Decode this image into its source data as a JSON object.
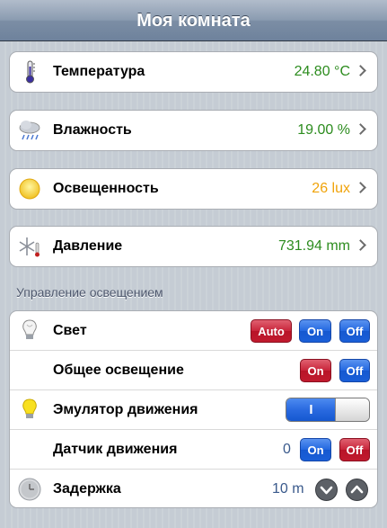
{
  "header": {
    "title": "Моя комната"
  },
  "sensors": [
    {
      "label": "Температура",
      "value": "24.80 °C",
      "icon": "thermometer-icon"
    },
    {
      "label": "Влажность",
      "value": "19.00 %",
      "icon": "rain-cloud-icon"
    },
    {
      "label": "Освещенность",
      "value": "26 lux",
      "icon": "sun-icon"
    },
    {
      "label": "Давление",
      "value": "731.94 mm",
      "icon": "snowflake-thermometer-icon"
    }
  ],
  "lighting": {
    "section_title": "Управление освещением",
    "light": {
      "label": "Свет",
      "auto": "Auto",
      "on": "On",
      "off": "Off",
      "icon": "lightbulb-icon"
    },
    "general": {
      "label": "Общее освещение",
      "on": "On",
      "off": "Off"
    },
    "emulator": {
      "label": "Эмулятор движения",
      "toggle_text": "I",
      "toggle_state": "on",
      "icon": "yellow-bulb-icon"
    },
    "motion": {
      "label": "Датчик движения",
      "value": "0",
      "on": "On",
      "off": "Off"
    },
    "delay": {
      "label": "Задержка",
      "value": "10 m",
      "icon": "clock-icon"
    }
  },
  "colors": {
    "accent_blue": "#1a5fd8",
    "accent_red": "#c11a2e",
    "value_green": "#2c8c1e",
    "value_orange": "#f0a30a"
  }
}
